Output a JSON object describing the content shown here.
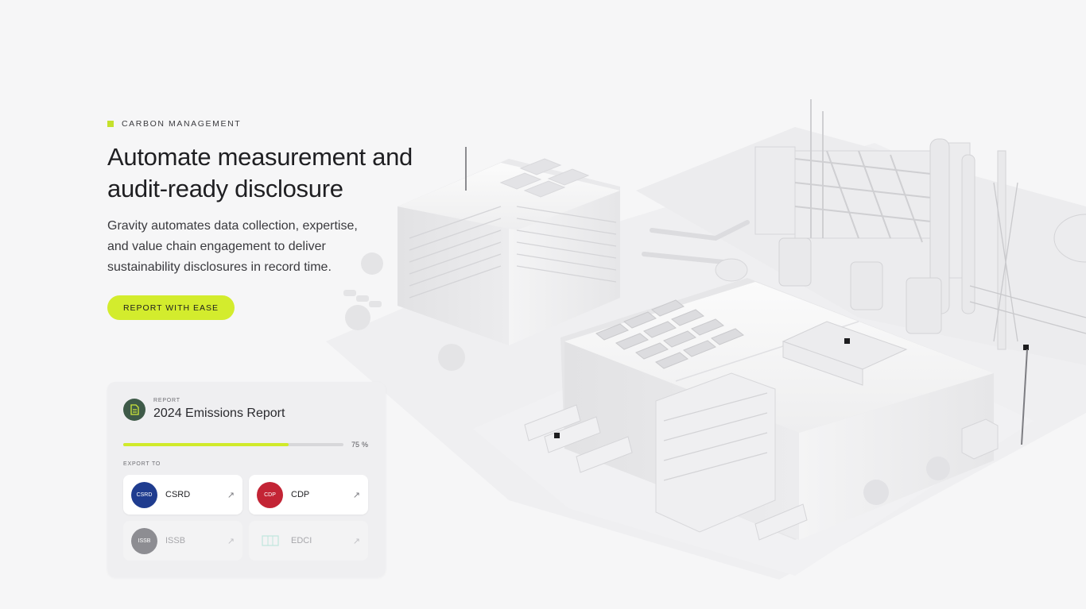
{
  "hero": {
    "eyebrow": "CARBON MANAGEMENT",
    "title_line1": "Automate measurement and",
    "title_line2": "audit-ready disclosure",
    "body_line1": "Gravity automates data collection, expertise,",
    "body_line2": "and value chain engagement to deliver",
    "body_line3": "sustainability disclosures in record time.",
    "cta_label": "REPORT WITH EASE"
  },
  "report_card": {
    "label": "REPORT",
    "title": "2024 Emissions Report",
    "progress_value": 75,
    "progress_text": "75",
    "progress_unit": "%",
    "export_label": "EXPORT TO",
    "targets": [
      {
        "name": "CSRD",
        "logo_text": "CSRD",
        "logo_color": "#1f3c8f",
        "arrow": "↗",
        "active": true
      },
      {
        "name": "CDP",
        "logo_text": "CDP",
        "logo_color": "#c32435",
        "arrow": "↗",
        "active": true
      },
      {
        "name": "ISSB",
        "logo_text": "ISSB",
        "logo_color": "#8d8d92",
        "arrow": "↗",
        "active": false
      },
      {
        "name": "EDCI",
        "logo_text": "",
        "logo_color": "#bfe6dd",
        "arrow": "↗",
        "active": false
      }
    ]
  },
  "colors": {
    "accent": "#d3ec2d",
    "doc_icon_bg": "#3e5a48",
    "background": "#f6f6f7"
  },
  "illustration": {
    "icon": "industrial-campus-illustration"
  }
}
